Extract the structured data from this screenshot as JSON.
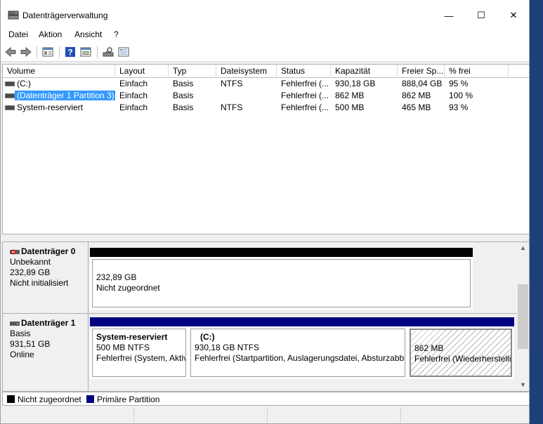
{
  "window": {
    "title": "Datenträgerverwaltung",
    "minimize_glyph": "—",
    "maximize_glyph": "☐",
    "close_glyph": "✕"
  },
  "menu": {
    "items": [
      "Datei",
      "Aktion",
      "Ansicht",
      "?"
    ]
  },
  "toolbar": {
    "icons": [
      "back-arrow-icon",
      "forward-arrow-icon",
      "properties-icon",
      "help-icon",
      "view-icon",
      "disk-rescan-icon",
      "settings-icon"
    ]
  },
  "volume_list": {
    "columns": [
      "Volume",
      "Layout",
      "Typ",
      "Dateisystem",
      "Status",
      "Kapazität",
      "Freier Sp...",
      "% frei"
    ],
    "rows": [
      {
        "volume": "(C:)",
        "layout": "Einfach",
        "typ": "Basis",
        "dateisystem": "NTFS",
        "status": "Fehlerfrei (...",
        "kapazitaet": "930,18 GB",
        "freier": "888,04 GB",
        "prozent": "95 %",
        "selected": false
      },
      {
        "volume": "(Datenträger 1 Partition 3)",
        "layout": "Einfach",
        "typ": "Basis",
        "dateisystem": "",
        "status": "Fehlerfrei (...",
        "kapazitaet": "862 MB",
        "freier": "862 MB",
        "prozent": "100 %",
        "selected": true
      },
      {
        "volume": "System-reserviert",
        "layout": "Einfach",
        "typ": "Basis",
        "dateisystem": "NTFS",
        "status": "Fehlerfrei (...",
        "kapazitaet": "500 MB",
        "freier": "465 MB",
        "prozent": "93 %",
        "selected": false
      }
    ]
  },
  "disks": [
    {
      "name": "Datenträger 0",
      "type": "Unbekannt",
      "size": "232,89 GB",
      "state": "Nicht initialisiert",
      "icon": "disk-error-icon",
      "partitions": [
        {
          "title": "",
          "size_line": "232,89 GB",
          "status_line": "Nicht zugeordnet",
          "bar_color": "#000000",
          "share": 1
        }
      ]
    },
    {
      "name": "Datenträger 1",
      "type": "Basis",
      "size": "931,51 GB",
      "state": "Online",
      "icon": "disk-icon",
      "partitions": [
        {
          "title": "System-reserviert",
          "size_line": "500 MB NTFS",
          "status_line": "Fehlerfrei (System, Aktiv, Primäre Partition)",
          "bar_color": "#000080",
          "share": 0.23
        },
        {
          "title": "(C:)",
          "size_line": "930,18 GB NTFS",
          "status_line": "Fehlerfrei (Startpartition, Auslagerungsdatei, Absturzabbild, Primäre Partition)",
          "bar_color": "#000080",
          "share": 0.51
        },
        {
          "title": "",
          "size_line": "862 MB",
          "status_line": "Fehlerfrei (Wiederherstellungspartition)",
          "bar_color": "#000080",
          "share": 0.26
        }
      ]
    }
  ],
  "legend": [
    {
      "label": "Nicht zugeordnet",
      "color": "#000000"
    },
    {
      "label": "Primäre Partition",
      "color": "#000080"
    }
  ]
}
